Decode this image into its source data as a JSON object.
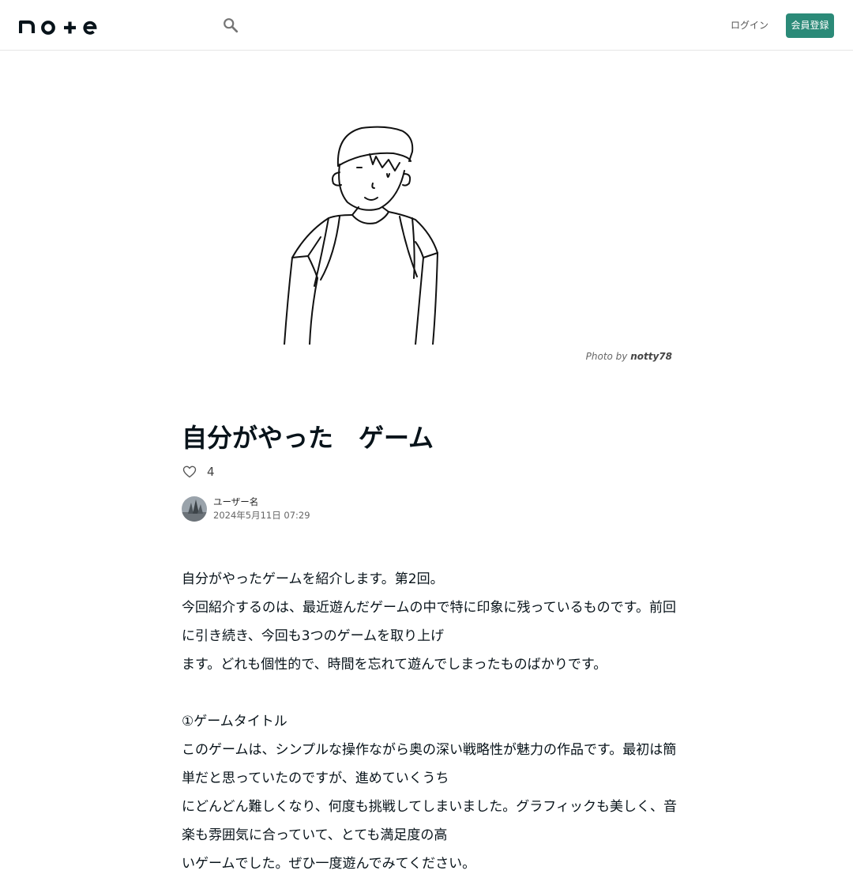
{
  "header": {
    "logo_text": "note",
    "login_label": "ログイン",
    "signup_label": "会員登録"
  },
  "hero": {
    "credit_prefix": "Photo by ",
    "credit_author": "notty78"
  },
  "article": {
    "title": "自分がやった　ゲーム",
    "like_count": "4",
    "author_name": "ユーザー名",
    "date": "2024年5月11日 07:29",
    "paragraphs": [
      "自分がやったゲームを紹介します。第2回。",
      "今回紹介するのは、最近遊んだゲームの中で特に印象に残っているものです。前回に引き続き、今回も3つのゲームを取り上げ",
      "ます。どれも個性的で、時間を忘れて遊んでしまったものばかりです。",
      "",
      "①ゲームタイトル",
      "このゲームは、シンプルな操作ながら奥の深い戦略性が魅力の作品です。最初は簡単だと思っていたのですが、進めていくうち",
      "にどんどん難しくなり、何度も挑戦してしまいました。グラフィックも美しく、音楽も雰囲気に合っていて、とても満足度の高",
      "いゲームでした。ぜひ一度遊んでみてください。"
    ]
  }
}
